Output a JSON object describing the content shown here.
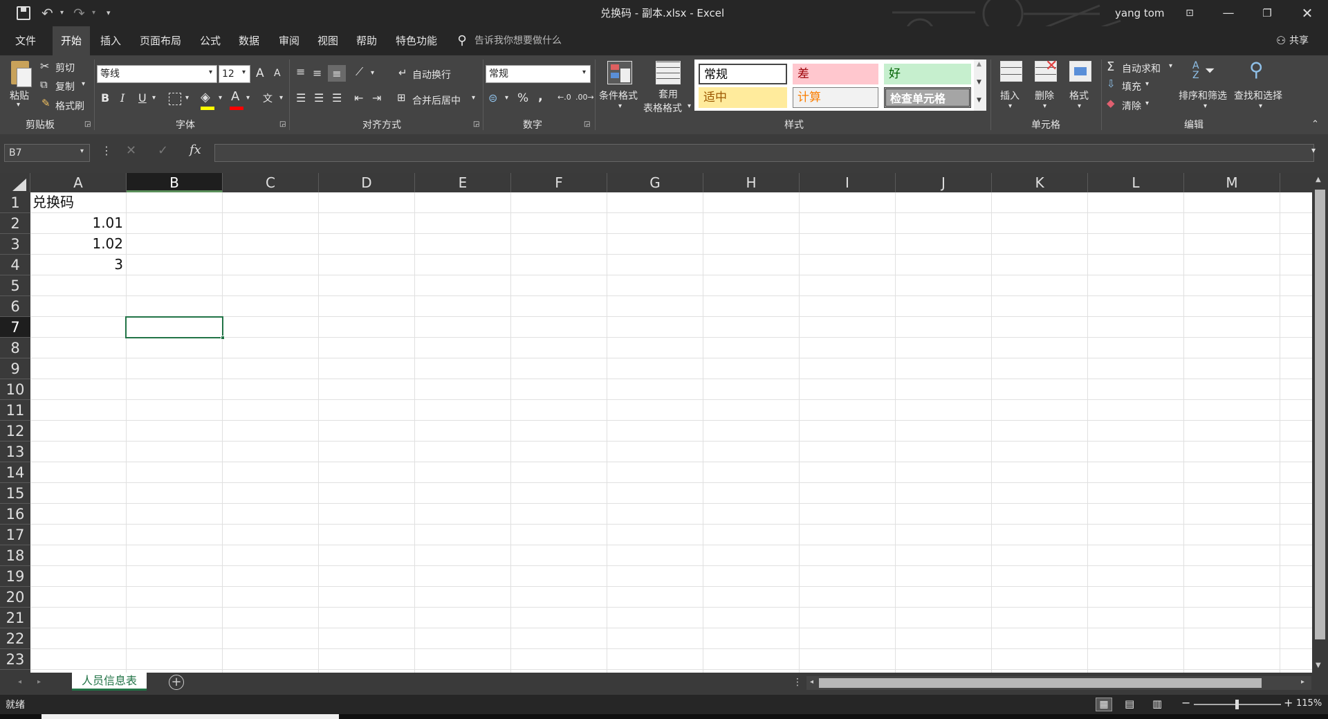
{
  "window": {
    "title": "兑换码 - 副本.xlsx  -  Excel",
    "user": "yang tom",
    "share": "共享"
  },
  "tabs": [
    "文件",
    "开始",
    "插入",
    "页面布局",
    "公式",
    "数据",
    "审阅",
    "视图",
    "帮助",
    "特色功能"
  ],
  "active_tab": "开始",
  "tell_me": "告诉我你想要做什么",
  "ribbon": {
    "clipboard": {
      "label": "剪贴板",
      "paste": "粘贴",
      "cut": "剪切",
      "copy": "复制",
      "format_painter": "格式刷"
    },
    "font": {
      "label": "字体",
      "name": "等线",
      "size": "12",
      "bold": "B",
      "italic": "I",
      "underline": "U",
      "font_color_glyph": "A",
      "grow": "A",
      "shrink": "A"
    },
    "alignment": {
      "label": "对齐方式",
      "wrap": "自动换行",
      "merge": "合并后居中"
    },
    "number": {
      "label": "数字",
      "format": "常规",
      "percent": "%",
      "comma": ","
    },
    "styles": {
      "label": "样式",
      "conditional": "条件格式",
      "table_format_1": "套用",
      "table_format_2": "表格格式",
      "items": [
        {
          "text": "常规",
          "color": "#000000",
          "bg": "#ffffff"
        },
        {
          "text": "差",
          "color": "#9c0006",
          "bg": "#ffc7ce"
        },
        {
          "text": "好",
          "color": "#006100",
          "bg": "#c6efce"
        },
        {
          "text": "适中",
          "color": "#9c5700",
          "bg": "#ffeb9c"
        },
        {
          "text": "计算",
          "color": "#fa7d00",
          "bg": "#f2f2f2"
        },
        {
          "text": "检查单元格",
          "color": "#ffffff",
          "bg": "#a5a5a5"
        }
      ]
    },
    "cells": {
      "label": "单元格",
      "insert": "插入",
      "delete": "删除",
      "format": "格式"
    },
    "editing": {
      "label": "编辑",
      "autosum": "自动求和",
      "fill": "填充",
      "clear": "清除",
      "sort": "排序和筛选",
      "find": "查找和选择"
    }
  },
  "formula_bar": {
    "name_box": "B7",
    "fx": "fx",
    "content": ""
  },
  "grid": {
    "columns": [
      "A",
      "B",
      "C",
      "D",
      "E",
      "F",
      "G",
      "H",
      "I",
      "J",
      "K",
      "L",
      "M"
    ],
    "rows": [
      "1",
      "2",
      "3",
      "4",
      "5",
      "6",
      "7",
      "8",
      "9",
      "10",
      "11",
      "12",
      "13",
      "14",
      "15",
      "16",
      "17",
      "18",
      "19",
      "20",
      "21",
      "22",
      "23"
    ],
    "selected_column": "B",
    "selected_row": "7",
    "cells": {
      "A1": "兑换码",
      "A2": "1.01",
      "A3": "1.02",
      "A4": "3"
    }
  },
  "sheets": [
    "人员信息表"
  ],
  "status": {
    "ready": "就绪",
    "zoom": "115%"
  },
  "colors": {
    "accent": "#217346",
    "dark_bg": "#262626",
    "ribbon_bg": "#444444",
    "sheet_tab_text": "#217346"
  }
}
